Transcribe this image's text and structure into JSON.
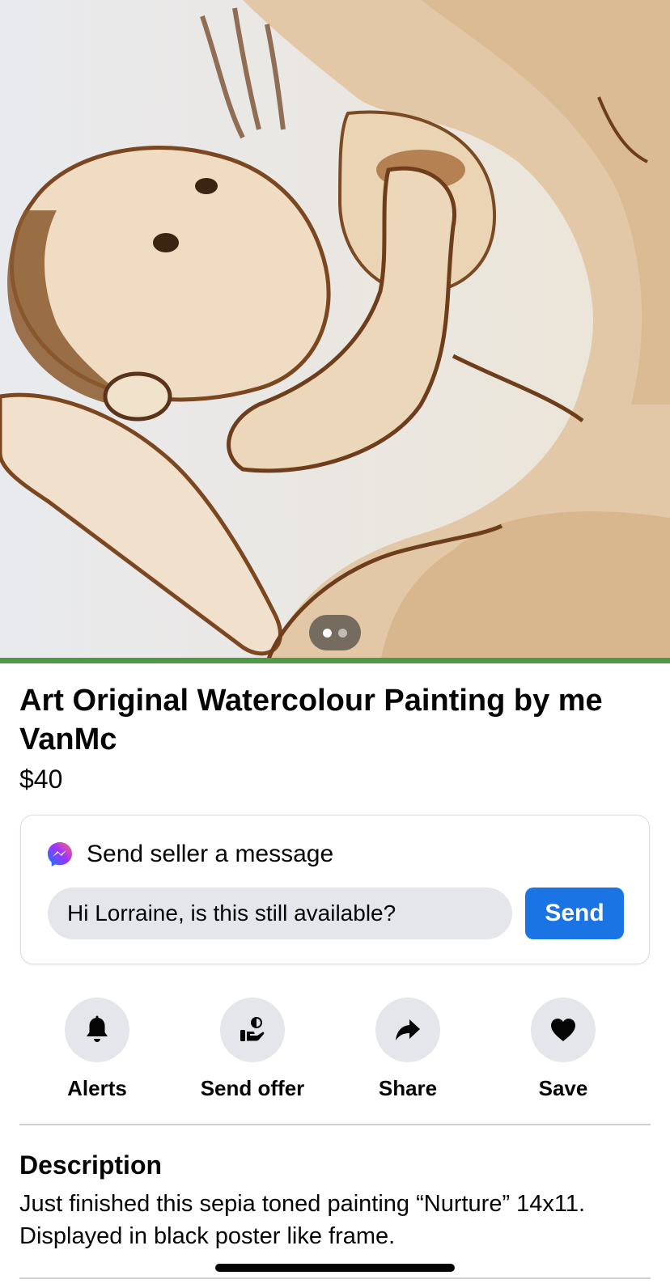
{
  "listing": {
    "title": "Art Original Watercolour Painting by me VanMc",
    "price": "$40",
    "photo_pager": {
      "count": 2,
      "active_index": 0
    }
  },
  "message_card": {
    "header": "Send seller a message",
    "input_value": "Hi Lorraine, is this still available?",
    "send_label": "Send",
    "icon": "messenger-icon"
  },
  "actions": [
    {
      "id": "alerts",
      "label": "Alerts",
      "icon": "bell-icon"
    },
    {
      "id": "send-offer",
      "label": "Send offer",
      "icon": "offer-icon"
    },
    {
      "id": "share",
      "label": "Share",
      "icon": "share-icon"
    },
    {
      "id": "save",
      "label": "Save",
      "icon": "heart-icon"
    }
  ],
  "description": {
    "heading": "Description",
    "text": "Just finished this sepia toned painting “Nurture” 14x11. Displayed in black poster like frame."
  },
  "colors": {
    "accent": "#1b74e4",
    "chip_background": "#e4e6eb",
    "sepia": "#8a5a32"
  }
}
